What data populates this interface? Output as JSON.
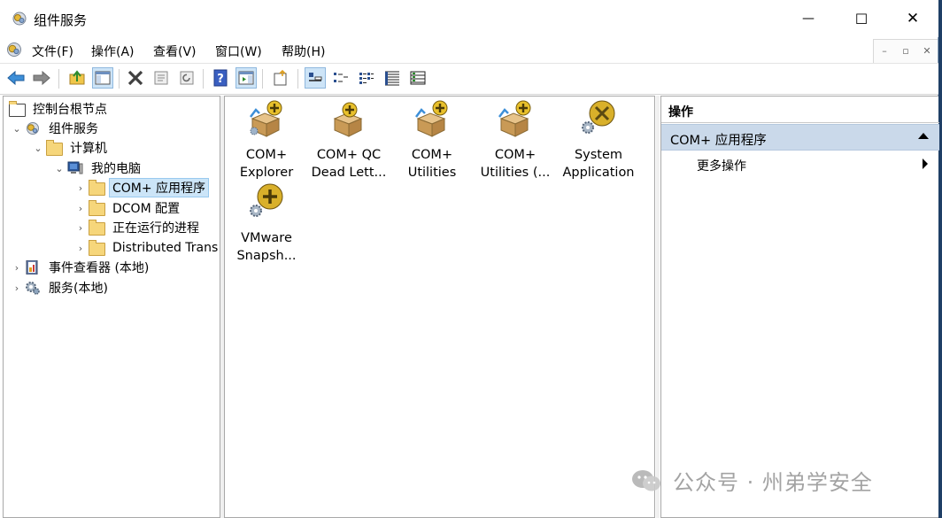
{
  "window": {
    "title": "组件服务",
    "minimize": "—",
    "maximize": "☐",
    "close": "✕"
  },
  "menu": [
    "文件(F)",
    "操作(A)",
    "查看(V)",
    "窗口(W)",
    "帮助(H)"
  ],
  "mdi_controls": [
    "–",
    "▫",
    "✕"
  ],
  "toolbar": {
    "icons": [
      "back-arrow-icon",
      "forward-arrow-icon",
      "up-folder-icon",
      "show-hide-tree-icon",
      "delete-icon",
      "properties-icon",
      "refresh-icon",
      "help-icon",
      "show-hide-action-pane-icon",
      "export-list-icon",
      "large-icons-view-icon",
      "small-icons-view-icon",
      "list-view-icon",
      "detail-view-icon",
      "status-view-icon"
    ]
  },
  "tree": [
    {
      "label": "控制台根节点",
      "level": 0,
      "expand": "",
      "icon": "folder-icon"
    },
    {
      "label": "组件服务",
      "level": 1,
      "expand": "⌄",
      "icon": "component-services-icon"
    },
    {
      "label": "计算机",
      "level": 2,
      "expand": "⌄",
      "icon": "folder-icon"
    },
    {
      "label": "我的电脑",
      "level": 3,
      "expand": "⌄",
      "icon": "computer-icon"
    },
    {
      "label": "COM+ 应用程序",
      "level": 4,
      "expand": "›",
      "icon": "folder-icon",
      "selected": true
    },
    {
      "label": "DCOM 配置",
      "level": 4,
      "expand": "›",
      "icon": "folder-icon"
    },
    {
      "label": "正在运行的进程",
      "level": 4,
      "expand": "›",
      "icon": "folder-icon"
    },
    {
      "label": "Distributed Trans",
      "level": 4,
      "expand": "›",
      "icon": "folder-icon"
    },
    {
      "label": "事件查看器 (本地)",
      "level": 0,
      "expand": "›",
      "icon": "event-viewer-icon"
    },
    {
      "label": "服务(本地)",
      "level": 0,
      "expand": "›",
      "icon": "services-gear-icon"
    }
  ],
  "apps": [
    {
      "line1": "COM+",
      "line2": "Explorer",
      "icon": "com-app-box-icon"
    },
    {
      "line1": "COM+ QC",
      "line2": "Dead Lett...",
      "icon": "com-app-box-icon"
    },
    {
      "line1": "COM+",
      "line2": "Utilities",
      "icon": "com-app-box-icon"
    },
    {
      "line1": "COM+",
      "line2": "Utilities (...",
      "icon": "com-app-box-icon"
    },
    {
      "line1": "System",
      "line2": "Application",
      "icon": "system-app-icon"
    },
    {
      "line1": "VMware",
      "line2": "Snapsh...",
      "icon": "vmware-app-icon"
    }
  ],
  "actions": {
    "header": "操作",
    "group": "COM+ 应用程序",
    "more": "更多操作"
  },
  "watermark": "公众号 · 州弟学安全"
}
